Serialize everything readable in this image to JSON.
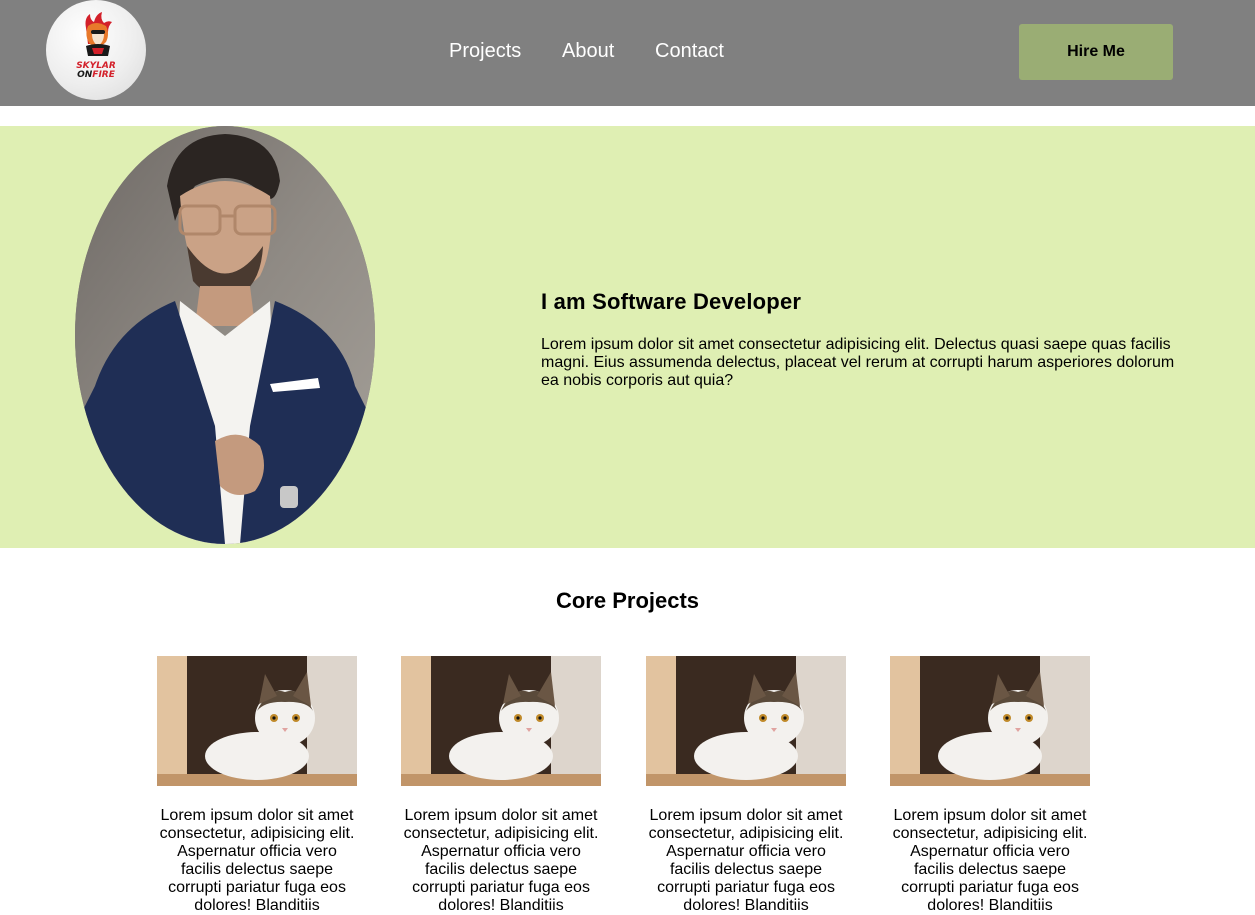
{
  "header": {
    "logo": {
      "line1": "SKYLAR",
      "line2a": "ON",
      "line2b": "FIRE",
      "icon": "fox-mascot-icon"
    },
    "nav": [
      {
        "label": "Projects"
      },
      {
        "label": "About"
      },
      {
        "label": "Contact"
      }
    ],
    "cta_label": "Hire Me"
  },
  "hero": {
    "title": "I am Software Developer",
    "text": "Lorem ipsum dolor sit amet consectetur adipisicing elit. Delectus quasi saepe quas facilis magni. Eius assumenda delectus, placeat vel rerum at corrupti harum asperiores dolorum ea nobis corporis aut quia?"
  },
  "projects": {
    "title": "Core Projects",
    "items": [
      {
        "description": "Lorem ipsum dolor sit amet consectetur, adipisicing elit. Aspernatur officia vero facilis delectus saepe corrupti pariatur fuga eos dolores! Blanditiis"
      },
      {
        "description": "Lorem ipsum dolor sit amet consectetur, adipisicing elit. Aspernatur officia vero facilis delectus saepe corrupti pariatur fuga eos dolores! Blanditiis"
      },
      {
        "description": "Lorem ipsum dolor sit amet consectetur, adipisicing elit. Aspernatur officia vero facilis delectus saepe corrupti pariatur fuga eos dolores! Blanditiis"
      },
      {
        "description": "Lorem ipsum dolor sit amet consectetur, adipisicing elit. Aspernatur officia vero facilis delectus saepe corrupti pariatur fuga eos dolores! Blanditiis"
      }
    ]
  },
  "colors": {
    "header_bg": "#808080",
    "hero_bg": "#dfefb3",
    "cta_bg": "#9aad74"
  }
}
